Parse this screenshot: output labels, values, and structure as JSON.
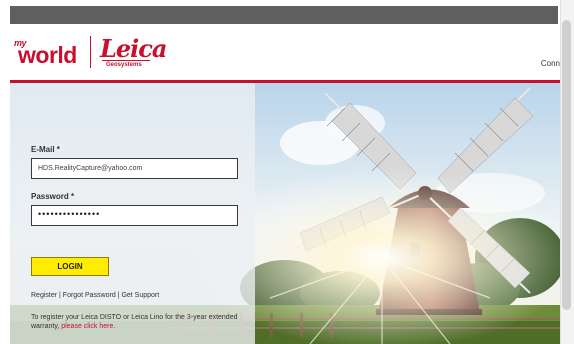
{
  "header": {
    "logo_my": "my",
    "logo_world": "world",
    "logo_brand": "Leica",
    "logo_sub": "Geosystems",
    "connect_text": "Conn"
  },
  "form": {
    "email_label": "E-Mail *",
    "email_value": "HDS.RealityCapture@yahoo.com",
    "password_label": "Password *",
    "password_value": "•••••••••••••••",
    "login_label": "LOGIN"
  },
  "links": {
    "register": "Register",
    "sep1": " | ",
    "forgot": "Forgot Password",
    "sep2": " | ",
    "support": "Get Support"
  },
  "note": {
    "text": "To register your Leica DISTO or Leica Lino for the 3-year extended warranty, ",
    "link": "please click here."
  },
  "colors": {
    "brand_red": "#c8102e",
    "button_yellow": "#ffec00"
  }
}
